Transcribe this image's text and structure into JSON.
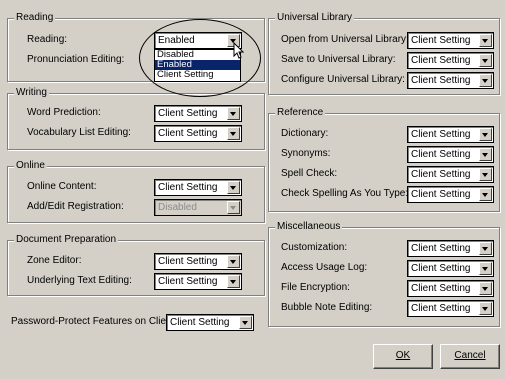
{
  "reading": {
    "legend": "Reading",
    "reading_label": "Reading:",
    "reading_value": "Enabled",
    "dropdown_options": [
      "Disabled",
      "Enabled",
      "Client Setting"
    ],
    "pronunciation_label": "Pronunciation Editing:"
  },
  "writing": {
    "legend": "Writing",
    "word_prediction_label": "Word Prediction:",
    "word_prediction_value": "Client Setting",
    "vocab_label": "Vocabulary List Editing:",
    "vocab_value": "Client Setting"
  },
  "online": {
    "legend": "Online",
    "content_label": "Online Content:",
    "content_value": "Client Setting",
    "registration_label": "Add/Edit Registration:",
    "registration_value": "Disabled"
  },
  "document_preparation": {
    "legend": "Document Preparation",
    "zone_label": "Zone Editor:",
    "zone_value": "Client Setting",
    "underlying_label": "Underlying Text Editing:",
    "underlying_value": "Client Setting"
  },
  "password": {
    "label": "Password-Protect Features on Client:",
    "value": "Client Setting"
  },
  "universal_library": {
    "legend": "Universal Library",
    "open_label": "Open from Universal Library:",
    "open_value": "Client Setting",
    "save_label": "Save to Universal Library:",
    "save_value": "Client Setting",
    "configure_label": "Configure Universal Library:",
    "configure_value": "Client Setting"
  },
  "reference": {
    "legend": "Reference",
    "dictionary_label": "Dictionary:",
    "dictionary_value": "Client Setting",
    "synonyms_label": "Synonyms:",
    "synonyms_value": "Client Setting",
    "spell_label": "Spell Check:",
    "spell_value": "Client Setting",
    "spell_type_label": "Check Spelling As You Type:",
    "spell_type_value": "Client Setting"
  },
  "miscellaneous": {
    "legend": "Miscellaneous",
    "customization_label": "Customization:",
    "customization_value": "Client Setting",
    "usage_label": "Access Usage Log:",
    "usage_value": "Client Setting",
    "encryption_label": "File Encryption:",
    "encryption_value": "Client Setting",
    "bubble_label": "Bubble Note Editing:",
    "bubble_value": "Client Setting"
  },
  "buttons": {
    "ok": "OK",
    "cancel": "Cancel"
  },
  "colors": {
    "dialog_bg": "#d4d0c8",
    "selection": "#0a246a"
  }
}
